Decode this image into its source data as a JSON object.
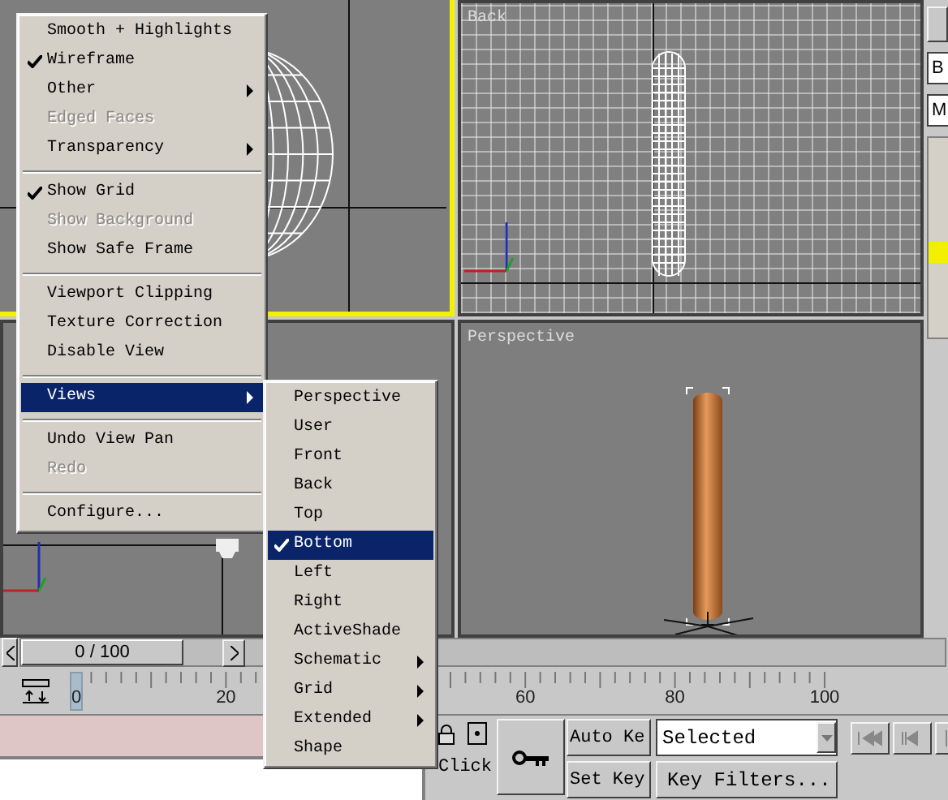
{
  "viewports": [
    {
      "kind": "sphere",
      "active": true,
      "grid": false
    },
    {
      "kind": "capsule",
      "label": "Back",
      "active": false,
      "grid": true
    },
    {
      "kind": "axes",
      "active": false,
      "grid": false
    },
    {
      "kind": "cylinder",
      "label": "Perspective",
      "active": false,
      "grid": false
    }
  ],
  "command_panel": {
    "fields": [
      "B",
      "M"
    ]
  },
  "time_slider": {
    "reading": "0 / 100",
    "level": 0
  },
  "track_bar": {
    "labels": [
      "0",
      "20",
      "60",
      "80",
      "100"
    ]
  },
  "status": {
    "prompt": "Click"
  },
  "key_controls": {
    "auto_key": "Auto Ke",
    "set_key": "Set Key",
    "selection": "Selected",
    "key_filters": "Key Filters..."
  },
  "context_menu": {
    "items": [
      {
        "kind": "item",
        "label": "Smooth + Highlights",
        "checked": false,
        "disabled": false,
        "submenu": false,
        "selected": false
      },
      {
        "kind": "item",
        "label": "Wireframe",
        "checked": true,
        "disabled": false,
        "submenu": false,
        "selected": false
      },
      {
        "kind": "item",
        "label": "Other",
        "checked": false,
        "disabled": false,
        "submenu": true,
        "selected": false
      },
      {
        "kind": "item",
        "label": "Edged Faces",
        "checked": false,
        "disabled": true,
        "submenu": false,
        "selected": false
      },
      {
        "kind": "item",
        "label": "Transparency",
        "checked": false,
        "disabled": false,
        "submenu": true,
        "selected": false
      },
      {
        "kind": "separator"
      },
      {
        "kind": "item",
        "label": "Show Grid",
        "checked": true,
        "disabled": false,
        "submenu": false,
        "selected": false
      },
      {
        "kind": "item",
        "label": "Show Background",
        "checked": false,
        "disabled": true,
        "submenu": false,
        "selected": false
      },
      {
        "kind": "item",
        "label": "Show Safe Frame",
        "checked": false,
        "disabled": false,
        "submenu": false,
        "selected": false
      },
      {
        "kind": "separator"
      },
      {
        "kind": "item",
        "label": "Viewport Clipping",
        "checked": false,
        "disabled": false,
        "submenu": false,
        "selected": false
      },
      {
        "kind": "item",
        "label": "Texture Correction",
        "checked": false,
        "disabled": false,
        "submenu": false,
        "selected": false
      },
      {
        "kind": "item",
        "label": "Disable View",
        "checked": false,
        "disabled": false,
        "submenu": false,
        "selected": false
      },
      {
        "kind": "separator"
      },
      {
        "kind": "item",
        "label": "Views",
        "checked": false,
        "disabled": false,
        "submenu": true,
        "selected": true
      },
      {
        "kind": "separator"
      },
      {
        "kind": "item",
        "label": "Undo View Pan",
        "checked": false,
        "disabled": false,
        "submenu": false,
        "selected": false
      },
      {
        "kind": "item",
        "label": "Redo",
        "checked": false,
        "disabled": true,
        "submenu": false,
        "selected": false
      },
      {
        "kind": "separator"
      },
      {
        "kind": "item",
        "label": "Configure...",
        "checked": false,
        "disabled": false,
        "submenu": false,
        "selected": false
      }
    ]
  },
  "views_submenu": {
    "items": [
      {
        "kind": "item",
        "label": "Perspective",
        "checked": false,
        "disabled": false,
        "submenu": false,
        "selected": false
      },
      {
        "kind": "item",
        "label": "User",
        "checked": false,
        "disabled": false,
        "submenu": false,
        "selected": false
      },
      {
        "kind": "item",
        "label": "Front",
        "checked": false,
        "disabled": false,
        "submenu": false,
        "selected": false
      },
      {
        "kind": "item",
        "label": "Back",
        "checked": false,
        "disabled": false,
        "submenu": false,
        "selected": false
      },
      {
        "kind": "item",
        "label": "Top",
        "checked": false,
        "disabled": false,
        "submenu": false,
        "selected": false
      },
      {
        "kind": "item",
        "label": "Bottom",
        "checked": true,
        "disabled": false,
        "submenu": false,
        "selected": true
      },
      {
        "kind": "item",
        "label": "Left",
        "checked": false,
        "disabled": false,
        "submenu": false,
        "selected": false
      },
      {
        "kind": "item",
        "label": "Right",
        "checked": false,
        "disabled": false,
        "submenu": false,
        "selected": false
      },
      {
        "kind": "item",
        "label": "ActiveShade",
        "checked": false,
        "disabled": false,
        "submenu": false,
        "selected": false
      },
      {
        "kind": "item",
        "label": "Schematic",
        "checked": false,
        "disabled": false,
        "submenu": true,
        "selected": false
      },
      {
        "kind": "item",
        "label": "Grid",
        "checked": false,
        "disabled": false,
        "submenu": true,
        "selected": false
      },
      {
        "kind": "item",
        "label": "Extended",
        "checked": false,
        "disabled": false,
        "submenu": true,
        "selected": false
      },
      {
        "kind": "item",
        "label": "Shape",
        "checked": false,
        "disabled": false,
        "submenu": false,
        "selected": false
      }
    ]
  }
}
